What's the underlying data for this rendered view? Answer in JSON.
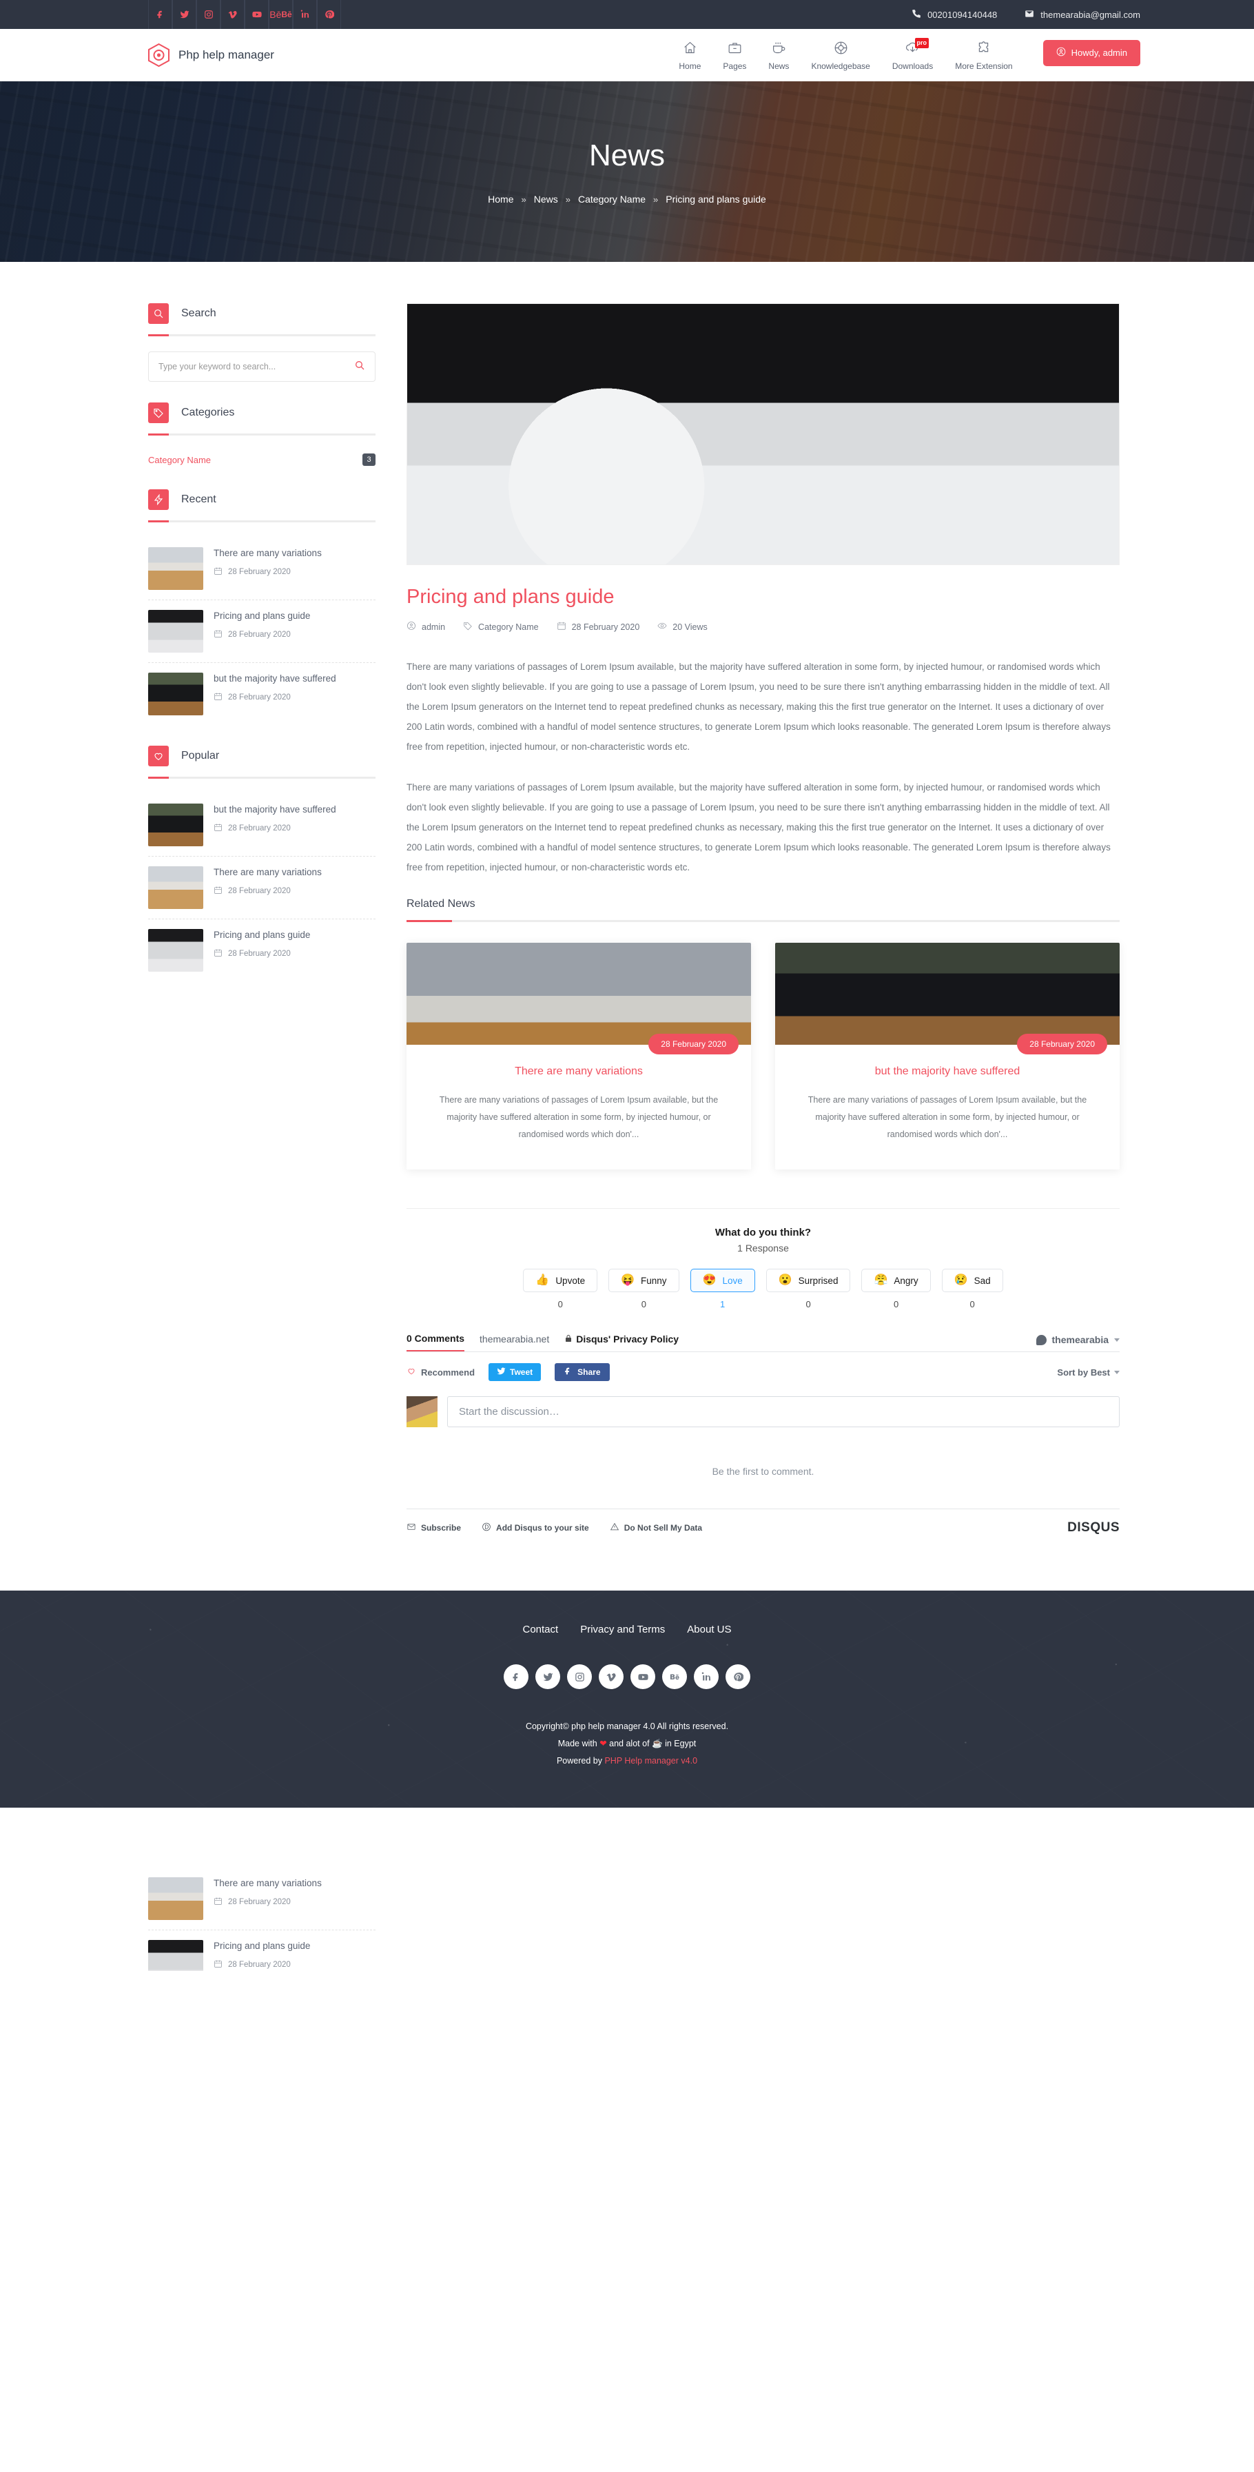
{
  "topbar": {
    "social": [
      {
        "name": "facebook-icon",
        "label": "f"
      },
      {
        "name": "twitter-icon",
        "label": "t"
      },
      {
        "name": "instagram-icon",
        "label": "ig"
      },
      {
        "name": "vimeo-icon",
        "label": "v"
      },
      {
        "name": "youtube-icon",
        "label": "yt"
      },
      {
        "name": "behance-icon",
        "label": "Bē"
      },
      {
        "name": "linkedin-icon",
        "label": "in"
      },
      {
        "name": "pinterest-icon",
        "label": "p"
      }
    ],
    "phone": "00201094140448",
    "email": "themearabia@gmail.com"
  },
  "header": {
    "brand": "Php help manager",
    "nav": [
      {
        "label": "Home",
        "icon": "home-icon"
      },
      {
        "label": "Pages",
        "icon": "briefcase-icon"
      },
      {
        "label": "News",
        "icon": "coffee-cup-icon"
      },
      {
        "label": "Knowledgebase",
        "icon": "lifebuoy-icon"
      },
      {
        "label": "Downloads",
        "icon": "download-icon",
        "badge": "pro"
      },
      {
        "label": "More Extension",
        "icon": "puzzle-icon"
      }
    ],
    "account_button": "Howdy, admin"
  },
  "hero": {
    "title": "News",
    "breadcrumb": [
      "Home",
      "News",
      "Category Name",
      "Pricing and plans guide"
    ],
    "separator": "»"
  },
  "sidebar": {
    "search": {
      "title": "Search",
      "icon": "search-icon",
      "placeholder": "Type your keyword to search...",
      "value": ""
    },
    "categories": {
      "title": "Categories",
      "icon": "tag-icon",
      "items": [
        {
          "label": "Category Name",
          "count": "3"
        }
      ]
    },
    "recent": {
      "title": "Recent",
      "icon": "bolt-icon",
      "items": [
        {
          "title": "There are many variations",
          "date": "28 February 2020",
          "thumb": "glasses"
        },
        {
          "title": "Pricing and plans guide",
          "date": "28 February 2020",
          "thumb": "imac"
        },
        {
          "title": "but the majority have suffered",
          "date": "28 February 2020",
          "thumb": "laptop"
        }
      ]
    },
    "popular": {
      "title": "Popular",
      "icon": "heart-icon",
      "items": [
        {
          "title": "but the majority have suffered",
          "date": "28 February 2020",
          "thumb": "laptop"
        },
        {
          "title": "There are many variations",
          "date": "28 February 2020",
          "thumb": "glasses"
        },
        {
          "title": "Pricing and plans guide",
          "date": "28 February 2020",
          "thumb": "imac"
        }
      ]
    },
    "overflow_items": [
      {
        "title": "There are many variations",
        "date": "28 February 2020",
        "thumb": "glasses"
      },
      {
        "title": "Pricing and plans guide",
        "date": "28 February 2020",
        "thumb": "imac"
      }
    ]
  },
  "article": {
    "title": "Pricing and plans guide",
    "meta": {
      "author": "admin",
      "category": "Category Name",
      "date": "28 February 2020",
      "views": "20 Views"
    },
    "paragraph1": "There are many variations of passages of Lorem Ipsum available, but the majority have suffered alteration in some form, by injected humour, or randomised words which don't look even slightly believable. If you are going to use a passage of Lorem Ipsum, you need to be sure there isn't anything embarrassing hidden in the middle of text. All the Lorem Ipsum generators on the Internet tend to repeat predefined chunks as necessary, making this the first true generator on the Internet. It uses a dictionary of over 200 Latin words, combined with a handful of model sentence structures, to generate Lorem Ipsum which looks reasonable. The generated Lorem Ipsum is therefore always free from repetition, injected humour, or non-characteristic words etc.",
    "paragraph2": "There are many variations of passages of Lorem Ipsum available, but the majority have suffered alteration in some form, by injected humour, or randomised words which don't look even slightly believable. If you are going to use a passage of Lorem Ipsum, you need to be sure there isn't anything embarrassing hidden in the middle of text. All the Lorem Ipsum generators on the Internet tend to repeat predefined chunks as necessary, making this the first true generator on the Internet. It uses a dictionary of over 200 Latin words, combined with a handful of model sentence structures, to generate Lorem Ipsum which looks reasonable. The generated Lorem Ipsum is therefore always free from repetition, injected humour, or non-characteristic words etc."
  },
  "related": {
    "title": "Related News",
    "cards": [
      {
        "date": "28 February 2020",
        "title": "There are many variations",
        "excerpt": "There are many variations of passages of Lorem Ipsum available, but the majority have suffered alteration in some form, by injected humour, or randomised words which don'...",
        "image": "glasses-desk"
      },
      {
        "date": "28 February 2020",
        "title": "but the majority have suffered",
        "excerpt": "There are many variations of passages of Lorem Ipsum available, but the majority have suffered alteration in some form, by injected humour, or randomised words which don'...",
        "image": "laptop-cafe"
      }
    ]
  },
  "disqus": {
    "question": "What do you think?",
    "response_count": "1 Response",
    "reactions": [
      {
        "label": "Upvote",
        "emoji": "👍",
        "count": "0",
        "active": false
      },
      {
        "label": "Funny",
        "emoji": "😝",
        "count": "0",
        "active": false
      },
      {
        "label": "Love",
        "emoji": "😍",
        "count": "1",
        "active": true
      },
      {
        "label": "Surprised",
        "emoji": "😮",
        "count": "0",
        "active": false
      },
      {
        "label": "Angry",
        "emoji": "😤",
        "count": "0",
        "active": false
      },
      {
        "label": "Sad",
        "emoji": "😢",
        "count": "0",
        "active": false
      }
    ],
    "comments_count": "0 Comments",
    "site": "themearabia.net",
    "privacy_policy": "Disqus' Privacy Policy",
    "user": "themearabia",
    "recommend": "Recommend",
    "tweet": "Tweet",
    "share": "Share",
    "sort": "Sort by Best",
    "compose_placeholder": "Start the discussion…",
    "empty_message": "Be the first to comment.",
    "footer_links": [
      "Subscribe",
      "Add Disqus to your site",
      "Do Not Sell My Data"
    ],
    "logo": "DISQUS"
  },
  "footer": {
    "nav": [
      "Contact",
      "Privacy and Terms",
      "About US"
    ],
    "social": [
      {
        "name": "facebook-icon"
      },
      {
        "name": "twitter-icon"
      },
      {
        "name": "instagram-icon"
      },
      {
        "name": "vimeo-icon"
      },
      {
        "name": "youtube-icon"
      },
      {
        "name": "behance-icon"
      },
      {
        "name": "linkedin-icon"
      },
      {
        "name": "pinterest-icon"
      }
    ],
    "copyright": "Copyright© php help manager 4.0 All rights reserved.",
    "made_prefix": "Made with",
    "made_middle": "and alot of",
    "made_suffix": "in Egypt",
    "powered_prefix": "Powered by",
    "powered_link": "PHP Help manager v4.0"
  },
  "colors": {
    "accent": "#f0515f",
    "dark": "#2f3542",
    "link_blue": "#2e9fff"
  }
}
